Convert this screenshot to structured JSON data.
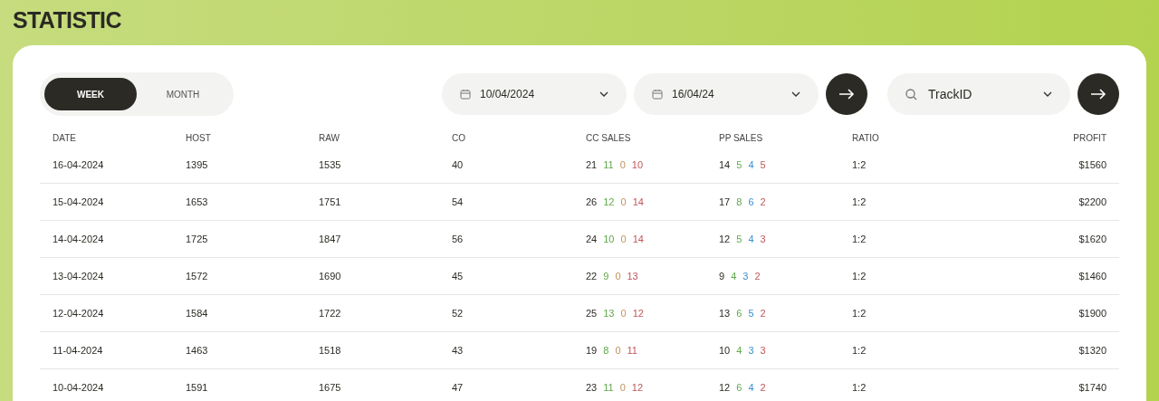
{
  "page_title": "STATISTIC",
  "period_tabs": [
    {
      "label": "WEEK",
      "selected": true
    },
    {
      "label": "MONTH",
      "selected": false
    }
  ],
  "date_from": {
    "value": "10/04/2024"
  },
  "date_to": {
    "value": "16/04/24"
  },
  "track_select": {
    "value": "TrackID"
  },
  "table": {
    "columns": [
      "DATE",
      "HOST",
      "RAW",
      "CO",
      "CC SALES",
      "PP SALES",
      "RATIO",
      "PROFIT"
    ],
    "rows": [
      {
        "date": "16-04-2024",
        "host": "1395",
        "raw": "1535",
        "co": "40",
        "cc_sales": [
          "21",
          "11",
          "0",
          "10"
        ],
        "pp_sales": [
          "14",
          "5",
          "4",
          "5"
        ],
        "ratio": "1:2",
        "profit": "$1560"
      },
      {
        "date": "15-04-2024",
        "host": "1653",
        "raw": "1751",
        "co": "54",
        "cc_sales": [
          "26",
          "12",
          "0",
          "14"
        ],
        "pp_sales": [
          "17",
          "8",
          "6",
          "2"
        ],
        "ratio": "1:2",
        "profit": "$2200"
      },
      {
        "date": "14-04-2024",
        "host": "1725",
        "raw": "1847",
        "co": "56",
        "cc_sales": [
          "24",
          "10",
          "0",
          "14"
        ],
        "pp_sales": [
          "12",
          "5",
          "4",
          "3"
        ],
        "ratio": "1:2",
        "profit": "$1620"
      },
      {
        "date": "13-04-2024",
        "host": "1572",
        "raw": "1690",
        "co": "45",
        "cc_sales": [
          "22",
          "9",
          "0",
          "13"
        ],
        "pp_sales": [
          "9",
          "4",
          "3",
          "2"
        ],
        "ratio": "1:2",
        "profit": "$1460"
      },
      {
        "date": "12-04-2024",
        "host": "1584",
        "raw": "1722",
        "co": "52",
        "cc_sales": [
          "25",
          "13",
          "0",
          "12"
        ],
        "pp_sales": [
          "13",
          "6",
          "5",
          "2"
        ],
        "ratio": "1:2",
        "profit": "$1900"
      },
      {
        "date": "11-04-2024",
        "host": "1463",
        "raw": "1518",
        "co": "43",
        "cc_sales": [
          "19",
          "8",
          "0",
          "11"
        ],
        "pp_sales": [
          "10",
          "4",
          "3",
          "3"
        ],
        "ratio": "1:2",
        "profit": "$1320"
      },
      {
        "date": "10-04-2024",
        "host": "1591",
        "raw": "1675",
        "co": "47",
        "cc_sales": [
          "23",
          "11",
          "0",
          "12"
        ],
        "pp_sales": [
          "12",
          "6",
          "4",
          "2"
        ],
        "ratio": "1:2",
        "profit": "$1740"
      }
    ]
  }
}
